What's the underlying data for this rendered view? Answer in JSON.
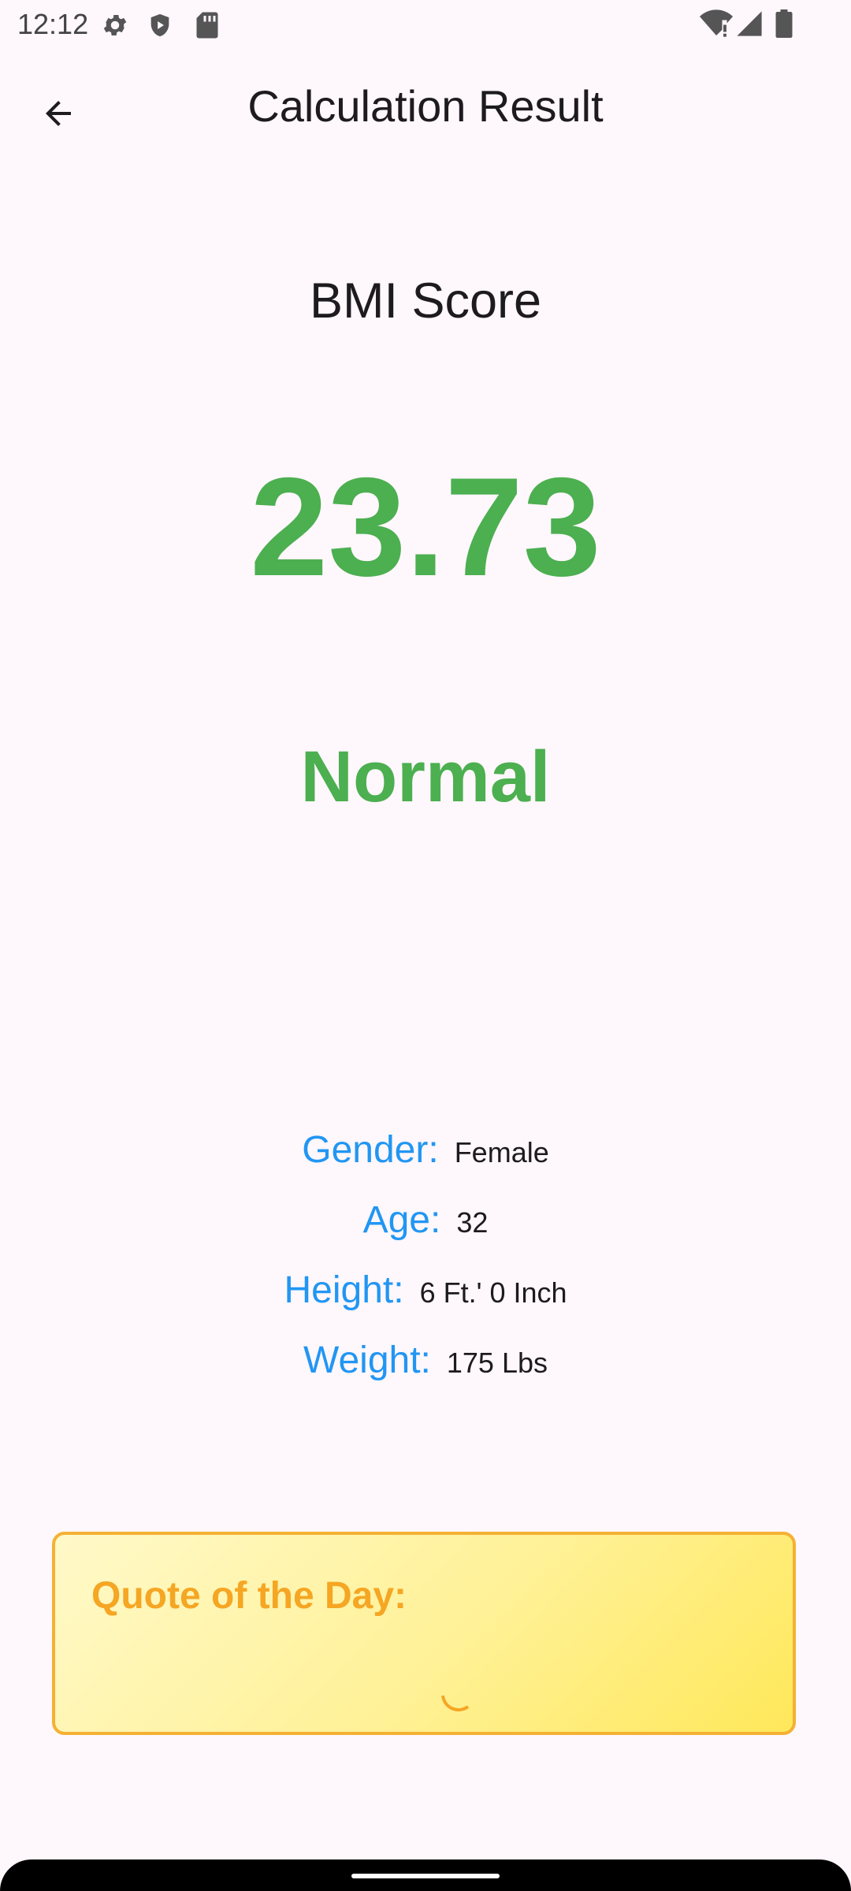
{
  "status_bar": {
    "time": "12:12",
    "icons": [
      "gear-icon",
      "shield-icon",
      "sd-card-icon",
      "wifi-alert-icon",
      "signal-icon",
      "battery-icon"
    ]
  },
  "app_bar": {
    "back_icon": "arrow-back-icon",
    "title": "Calculation Result"
  },
  "result": {
    "heading": "BMI Score",
    "value": "23.73",
    "category": "Normal"
  },
  "details": [
    {
      "label": "Gender:",
      "value": "Female"
    },
    {
      "label": "Age:",
      "value": "32"
    },
    {
      "label": "Height:",
      "value": "6 Ft.' 0 Inch"
    },
    {
      "label": "Weight:",
      "value": "175 Lbs"
    }
  ],
  "quote": {
    "title": "Quote of the Day:",
    "loading_icon": "loading-spinner-icon"
  },
  "colors": {
    "background": "#fef7fb",
    "accent_green": "#4caf50",
    "label_blue": "#2196f3",
    "quote_orange": "#f5a623",
    "quote_border": "#f4b133"
  }
}
